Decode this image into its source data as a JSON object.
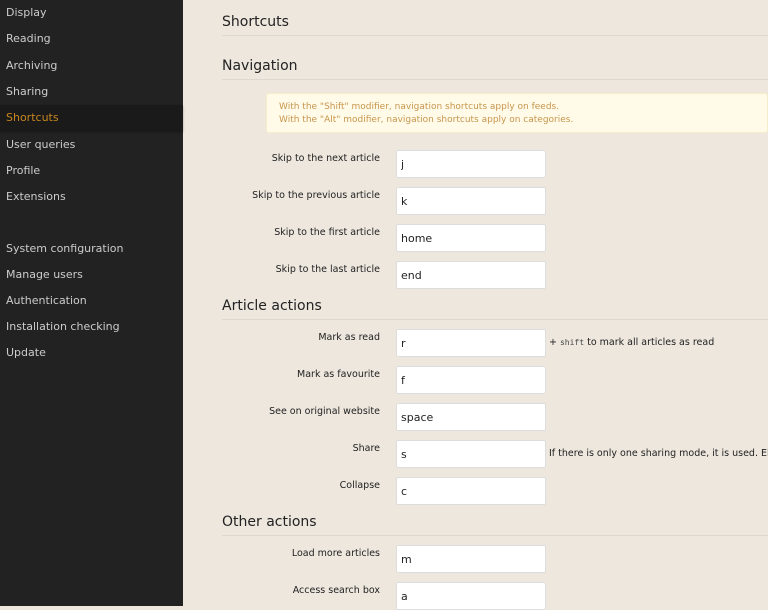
{
  "sidebar": {
    "items": [
      {
        "label": "Display"
      },
      {
        "label": "Reading"
      },
      {
        "label": "Archiving"
      },
      {
        "label": "Sharing"
      },
      {
        "label": "Shortcuts",
        "active": true
      },
      {
        "label": "User queries"
      },
      {
        "label": "Profile"
      },
      {
        "label": "Extensions"
      },
      {
        "label": "System configuration"
      },
      {
        "label": "Manage users"
      },
      {
        "label": "Authentication"
      },
      {
        "label": "Installation checking"
      },
      {
        "label": "Update"
      }
    ]
  },
  "colors": {
    "accent": "#c8861e",
    "sidebar_bg": "#222222",
    "page_bg": "#ede7de",
    "notice_bg": "#fffbe8"
  },
  "main": {
    "title": "Shortcuts",
    "navigation": {
      "heading": "Navigation",
      "notice": [
        "With the \"Shift\" modifier, navigation shortcuts apply on feeds.",
        "With the \"Alt\" modifier, navigation shortcuts apply on categories."
      ],
      "rows": [
        {
          "label": "Skip to the next article",
          "value": "j"
        },
        {
          "label": "Skip to the previous article",
          "value": "k"
        },
        {
          "label": "Skip to the first article",
          "value": "home"
        },
        {
          "label": "Skip to the last article",
          "value": "end"
        }
      ]
    },
    "article": {
      "heading": "Article actions",
      "rows": [
        {
          "label": "Mark as read",
          "value": "r",
          "help_prefix": "+ ",
          "help_code": "shift",
          "help_suffix": " to mark all articles as read"
        },
        {
          "label": "Mark as favourite",
          "value": "f"
        },
        {
          "label": "See on original website",
          "value": "space"
        },
        {
          "label": "Share",
          "value": "s",
          "help": "If there is only one sharing mode, it is used. Else mo"
        },
        {
          "label": "Collapse",
          "value": "c"
        }
      ]
    },
    "other": {
      "heading": "Other actions",
      "rows": [
        {
          "label": "Load more articles",
          "value": "m"
        },
        {
          "label": "Access search box",
          "value": "a"
        }
      ]
    }
  }
}
